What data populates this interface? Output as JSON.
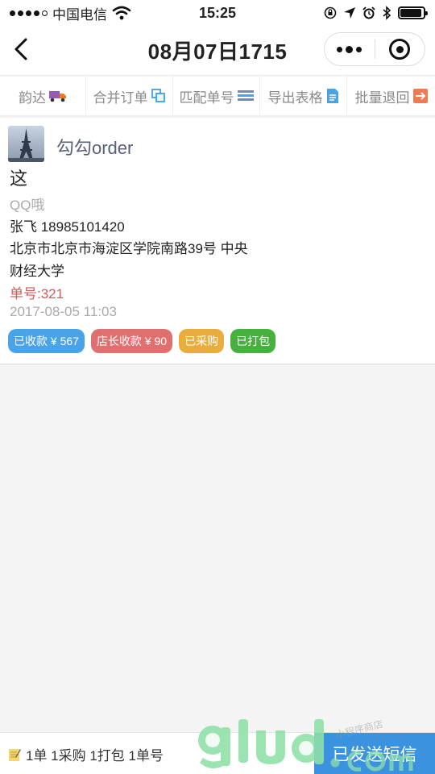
{
  "status_bar": {
    "carrier": "中国电信",
    "time": "15:25"
  },
  "nav": {
    "title": "08月07日1715"
  },
  "toolbar": {
    "items": [
      {
        "label": "韵达",
        "icon": "truck-icon"
      },
      {
        "label": "合并订单",
        "icon": "merge-icon"
      },
      {
        "label": "匹配单号",
        "icon": "barcode-icon"
      },
      {
        "label": "导出表格",
        "icon": "document-icon"
      },
      {
        "label": "批量退回",
        "icon": "return-arrow-icon"
      }
    ]
  },
  "order": {
    "shop_name": "勾勾order",
    "title": "这",
    "remark": "QQ哦",
    "contact": "张飞 18985101420",
    "address_line1": "北京市北京市海淀区学院南路39号 中央",
    "address_line2": "财经大学",
    "order_no": "单号:321",
    "time": "2017-08-05 11:03",
    "tags": [
      {
        "label": "已收款 ¥ 567",
        "color": "#4aa3e6"
      },
      {
        "label": "店长收款 ¥ 90",
        "color": "#e07070"
      },
      {
        "label": "已采购",
        "color": "#e9ad3f"
      },
      {
        "label": "已打包",
        "color": "#47b13f"
      }
    ]
  },
  "footer": {
    "summary": "1单 1采购 1打包 1单号",
    "sms_button": "已发送短信"
  },
  "colors": {
    "accent_blue": "#3b93e0",
    "watermark_green": "#8fe0a8"
  }
}
